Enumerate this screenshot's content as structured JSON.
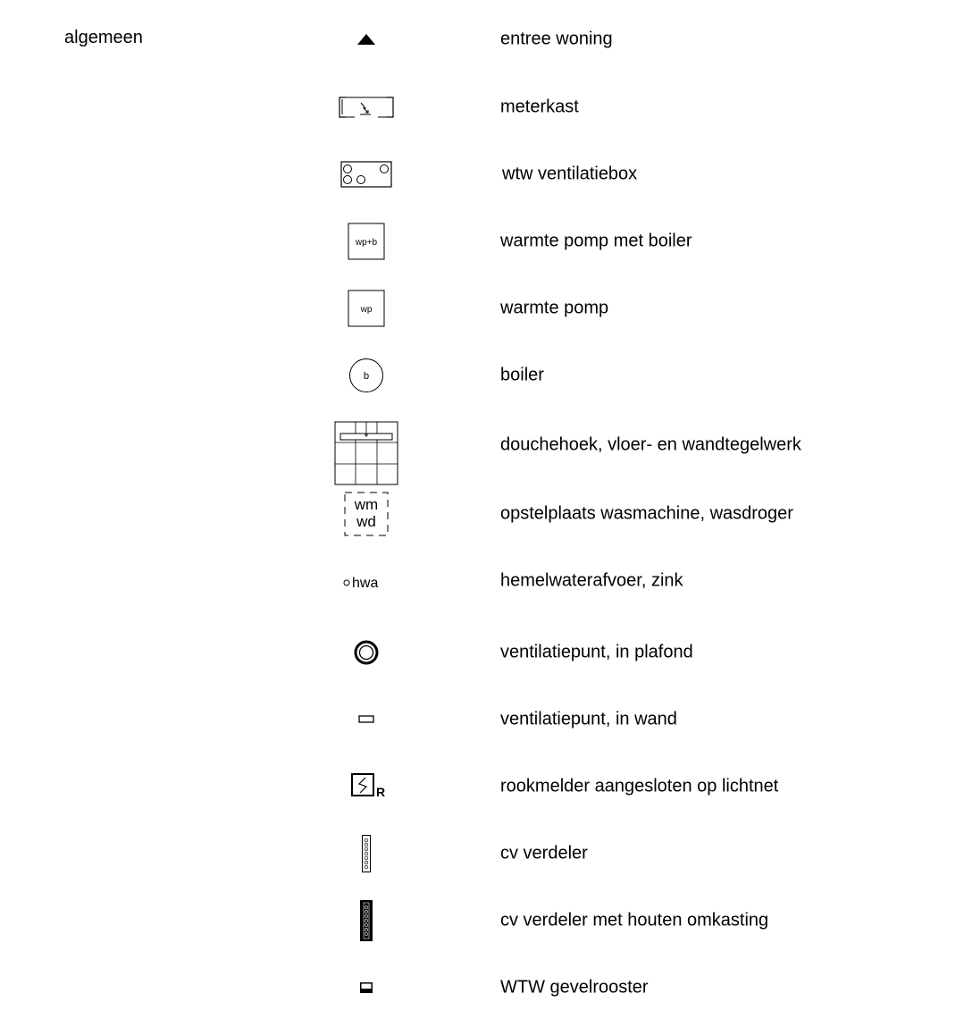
{
  "section_title": "algemeen",
  "legend": [
    {
      "icon": "entrance-triangle-icon",
      "label": "entree woning"
    },
    {
      "icon": "meter-cabinet-icon",
      "label": "meterkast"
    },
    {
      "icon": "ventilation-box-icon",
      "label": "wtw ventilatiebox"
    },
    {
      "icon": "heat-pump-boiler-icon",
      "icon_text": "wp+b",
      "label": "warmte pomp met boiler"
    },
    {
      "icon": "heat-pump-icon",
      "icon_text": "wp",
      "label": "warmte pomp"
    },
    {
      "icon": "boiler-icon",
      "icon_text": "b",
      "label": "boiler"
    },
    {
      "icon": "shower-tiles-icon",
      "label": "douchehoek, vloer- en wandtegelwerk"
    },
    {
      "icon": "washer-dryer-icon",
      "icon_text": [
        "wm",
        "wd"
      ],
      "label": "opstelplaats wasmachine, wasdroger"
    },
    {
      "icon": "rainwater-drain-icon",
      "icon_text": "hwa",
      "label": "hemelwaterafvoer, zink"
    },
    {
      "icon": "ceiling-vent-icon",
      "label": "ventilatiepunt, in plafond"
    },
    {
      "icon": "wall-vent-icon",
      "label": "ventilatiepunt, in wand"
    },
    {
      "icon": "smoke-detector-icon",
      "icon_text": "R",
      "label": "rookmelder aangesloten op lichtnet"
    },
    {
      "icon": "cv-manifold-icon",
      "label": "cv verdeler"
    },
    {
      "icon": "cv-manifold-boxed-icon",
      "label": "cv verdeler met houten omkasting"
    },
    {
      "icon": "facade-grille-icon",
      "label": "WTW gevelrooster"
    }
  ]
}
